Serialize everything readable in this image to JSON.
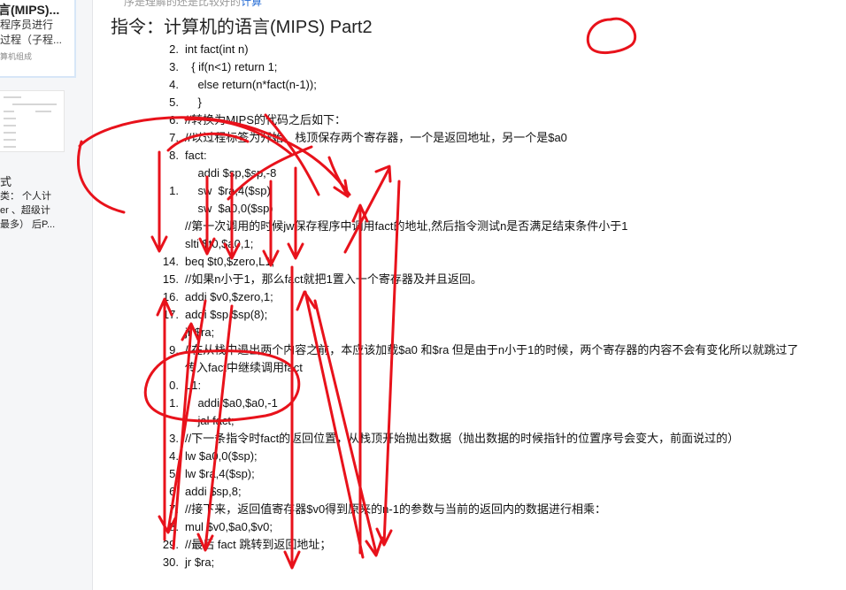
{
  "sidebar": {
    "card1": {
      "title": "言(MIPS)...",
      "line1": "程序员进行",
      "line2": "过程（子程...",
      "subtitle": "算机组成"
    },
    "card2": {
      "title": "式",
      "line1": "类：  个人计",
      "line2": "er 、超级计",
      "line3": "最多） 后P..."
    }
  },
  "header": {
    "faded_text": "序是理解的还是比较好的",
    "faded_link": "计算",
    "title": "指令：计算机的语言(MIPS) Part2"
  },
  "code_lines": [
    {
      "num": "2.",
      "text": "int fact(int n)"
    },
    {
      "num": "3.",
      "text": "  { if(n<1) return 1;"
    },
    {
      "num": "4.",
      "text": "    else return(n*fact(n-1));"
    },
    {
      "num": "5.",
      "text": "    }"
    },
    {
      "num": "6.",
      "text": "//转换为MIPS的代码之后如下："
    },
    {
      "num": "7.",
      "text": "//以过程标签为开始，栈顶保存两个寄存器，一个是返回地址，另一个是$a0"
    },
    {
      "num": "8.",
      "text": "fact:"
    },
    {
      "num": "",
      "text": "    addi $sp,$sp,-8"
    },
    {
      "num": "1.",
      "text": "    sw  $ra,4($sp)"
    },
    {
      "num": "",
      "text": "    sw  $a0,0($sp)"
    },
    {
      "num": "",
      "text": "//第一次调用的时候jw保存程序中调用fact的地址,然后指令测试n是否满足结束条件小于1"
    },
    {
      "num": "",
      "text": "slti $t0,$a0,1;"
    },
    {
      "num": "14.",
      "text": "beq $t0,$zero,L1;"
    },
    {
      "num": "15.",
      "text": "//如果n小于1，那么fact就把1置入一个寄存器及并且返回。"
    },
    {
      "num": "16.",
      "text": "addi $v0,$zero,1;"
    },
    {
      "num": "17.",
      "text": "addi $sp,$sp(8);"
    },
    {
      "num": "",
      "text": "jr $ra;"
    },
    {
      "num": "9.",
      "text": "//在从栈中退出两个内容之前，本应该加载$a0 和$ra 但是由于n小于1的时候，两个寄存器的内容不会有变化所以就跳过了"
    },
    {
      "num": "",
      "text": "传入fact中继续调用fact"
    },
    {
      "num": "0.",
      "text": "L1:"
    },
    {
      "num": "1.",
      "text": "    addi $a0,$a0,-1"
    },
    {
      "num": "",
      "text": "    jal fact;"
    },
    {
      "num": "3.",
      "text": "//下一条指令时fact的返回位置，从栈顶开始抛出数据（抛出数据的时候指针的位置序号会变大，前面说过的）"
    },
    {
      "num": "4.",
      "text": "lw $a0,0($sp);"
    },
    {
      "num": "5.",
      "text": "lw $ra,4($sp);"
    },
    {
      "num": "6.",
      "text": "addi $sp,8;"
    },
    {
      "num": "7.",
      "text": "//接下来，返回值寄存器$v0得到原来的n-1的参数与当前的返回内的数据进行相乘："
    },
    {
      "num": "8.",
      "text": "mul $v0,$a0,$v0;"
    },
    {
      "num": "29.",
      "text": "//最后 fact 跳转到返回地址；"
    },
    {
      "num": "30.",
      "text": "jr $ra;"
    }
  ],
  "annotation_color": "#e8121b"
}
